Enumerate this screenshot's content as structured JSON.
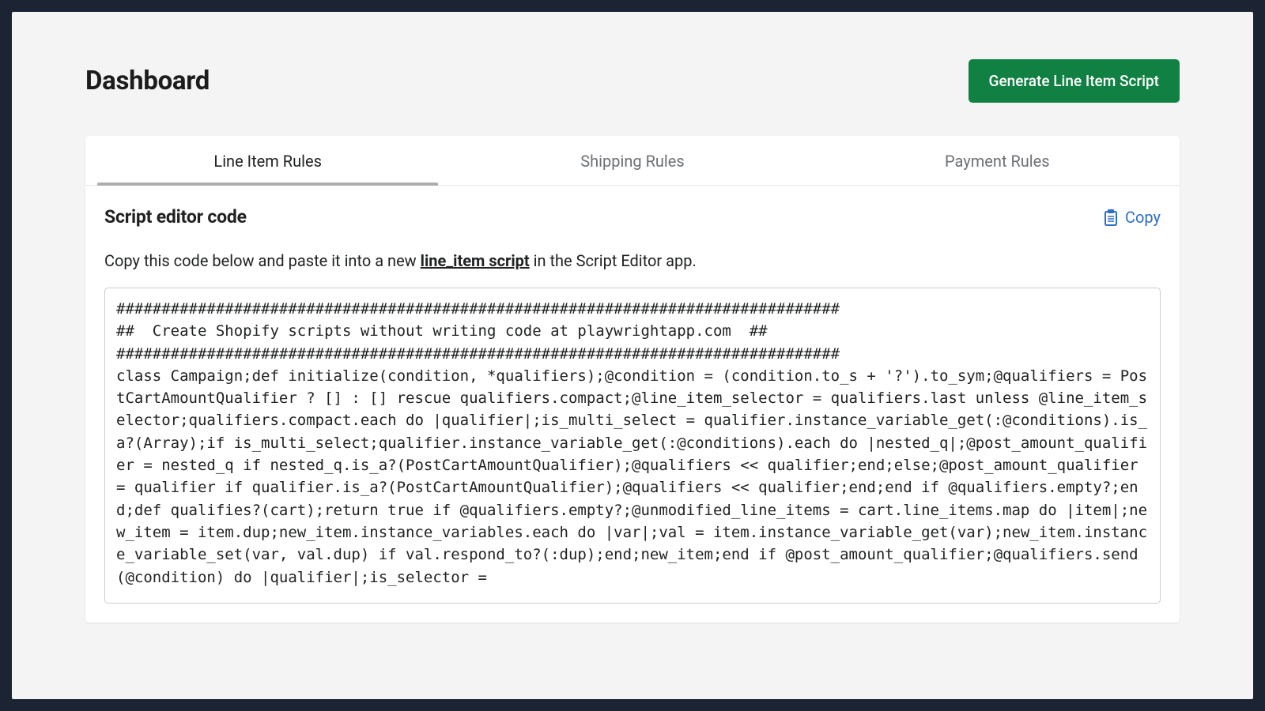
{
  "header": {
    "title": "Dashboard",
    "generate_button": "Generate Line Item Script"
  },
  "tabs": [
    {
      "label": "Line Item Rules",
      "active": true
    },
    {
      "label": "Shipping Rules",
      "active": false
    },
    {
      "label": "Payment Rules",
      "active": false
    }
  ],
  "editor": {
    "section_title": "Script editor code",
    "copy_label": "Copy",
    "instruction_prefix": "Copy this code below and paste it into a new ",
    "instruction_link": "line_item script",
    "instruction_suffix": " in the Script Editor app.",
    "code": "################################################################################\n##  Create Shopify scripts without writing code at playwrightapp.com  ##\n################################################################################\nclass Campaign;def initialize(condition, *qualifiers);@condition = (condition.to_s + '?').to_sym;@qualifiers = PostCartAmountQualifier ? [] : [] rescue qualifiers.compact;@line_item_selector = qualifiers.last unless @line_item_selector;qualifiers.compact.each do |qualifier|;is_multi_select = qualifier.instance_variable_get(:@conditions).is_a?(Array);if is_multi_select;qualifier.instance_variable_get(:@conditions).each do |nested_q|;@post_amount_qualifier = nested_q if nested_q.is_a?(PostCartAmountQualifier);@qualifiers << qualifier;end;else;@post_amount_qualifier = qualifier if qualifier.is_a?(PostCartAmountQualifier);@qualifiers << qualifier;end;end if @qualifiers.empty?;end;def qualifies?(cart);return true if @qualifiers.empty?;@unmodified_line_items = cart.line_items.map do |item|;new_item = item.dup;new_item.instance_variables.each do |var|;val = item.instance_variable_get(var);new_item.instance_variable_set(var, val.dup) if val.respond_to?(:dup);end;new_item;end if @post_amount_qualifier;@qualifiers.send(@condition) do |qualifier|;is_selector ="
  }
}
